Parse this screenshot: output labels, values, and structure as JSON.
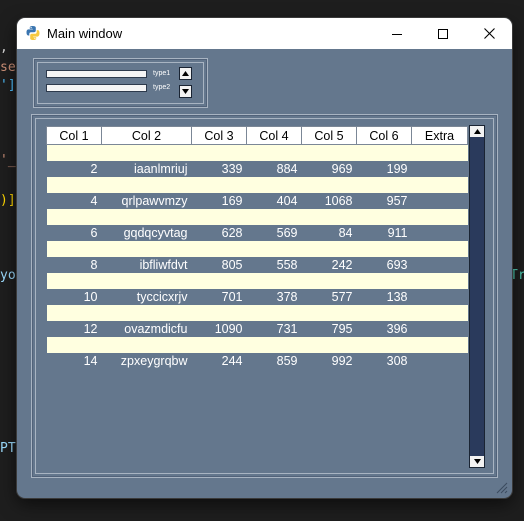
{
  "window": {
    "title": "Main window"
  },
  "controls": {
    "type1_label": "type1",
    "type2_label": "type2"
  },
  "table": {
    "headers": [
      "Col 1",
      "Col 2",
      "Col 3",
      "Col 4",
      "Col 5",
      "Col 6",
      "Extra"
    ],
    "rows": [
      [
        "",
        "",
        "",
        "",
        "",
        "",
        ""
      ],
      [
        "2",
        "iaanlmriuj",
        "339",
        "884",
        "969",
        "199",
        ""
      ],
      [
        "",
        "",
        "",
        "",
        "",
        "",
        ""
      ],
      [
        "4",
        "qrlpawvmzy",
        "169",
        "404",
        "1068",
        "957",
        ""
      ],
      [
        "",
        "",
        "",
        "",
        "",
        "",
        ""
      ],
      [
        "6",
        "gqdqcyvtag",
        "628",
        "569",
        "84",
        "911",
        ""
      ],
      [
        "",
        "",
        "",
        "",
        "",
        "",
        ""
      ],
      [
        "8",
        "ibfliwfdvt",
        "805",
        "558",
        "242",
        "693",
        ""
      ],
      [
        "",
        "",
        "",
        "",
        "",
        "",
        ""
      ],
      [
        "10",
        "tyccicxrjv",
        "701",
        "378",
        "577",
        "138",
        ""
      ],
      [
        "",
        "",
        "",
        "",
        "",
        "",
        ""
      ],
      [
        "12",
        "ovazmdicfu",
        "1090",
        "731",
        "795",
        "396",
        ""
      ],
      [
        "",
        "",
        "",
        "",
        "",
        "",
        ""
      ],
      [
        "14",
        "zpxeygrqbw",
        "244",
        "859",
        "992",
        "308",
        ""
      ]
    ]
  },
  "background_editor": {
    "fragments": [
      ",",
      "sea",
      "']",
      "'_",
      ")]",
      "yo",
      "PTE",
      "Tr"
    ]
  },
  "colors": {
    "window_bg": "#64778d",
    "row_alt": "#ffffe0",
    "scrollbar": "#2a3a5c"
  }
}
